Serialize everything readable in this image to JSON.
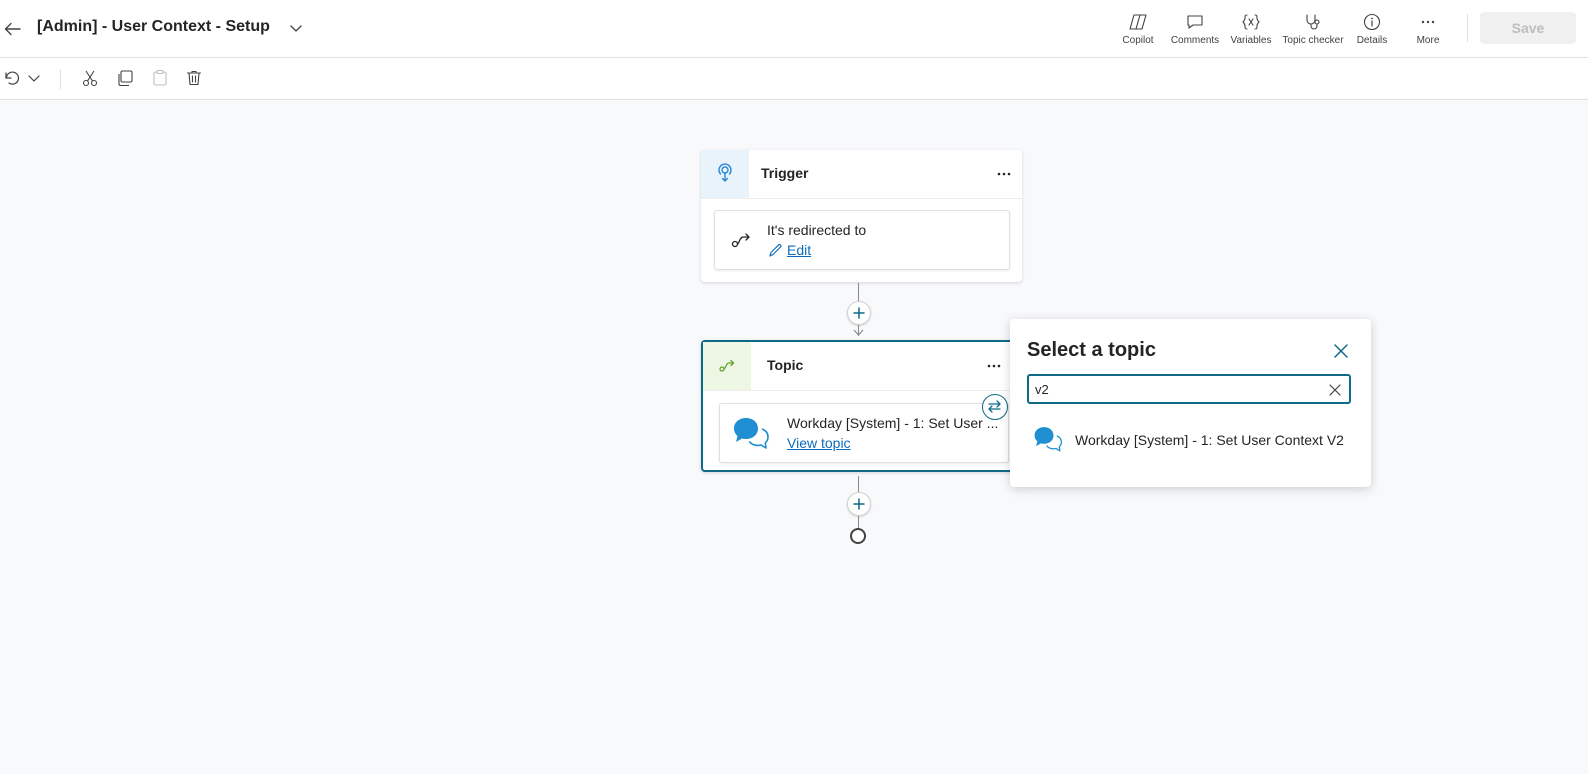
{
  "header": {
    "title": "[Admin] - User Context - Setup",
    "commands": [
      {
        "label": "Copilot",
        "icon": "copilot-icon"
      },
      {
        "label": "Comments",
        "icon": "comment-icon"
      },
      {
        "label": "Variables",
        "icon": "variables-icon"
      },
      {
        "label": "Topic checker",
        "icon": "stethoscope-icon"
      },
      {
        "label": "Details",
        "icon": "info-icon"
      },
      {
        "label": "More",
        "icon": "more-icon"
      }
    ],
    "save_label": "Save"
  },
  "toolbar": {
    "buttons": [
      "undo-icon",
      "chevron-down-icon",
      "cut-icon",
      "copy-icon",
      "paste-icon",
      "delete-icon"
    ]
  },
  "canvas": {
    "trigger_node": {
      "title": "Trigger",
      "condition": "It's redirected to",
      "edit_label": "Edit"
    },
    "topic_node": {
      "title": "Topic",
      "topic_name": "Workday [System] - 1: Set User ...",
      "view_label": "View topic"
    }
  },
  "popup": {
    "title": "Select a topic",
    "search_value": "v2",
    "results": [
      {
        "label": "Workday [System] - 1: Set User Context V2"
      }
    ]
  },
  "colors": {
    "accent": "#0f6a88",
    "link": "#0f6cbd",
    "trigger_icon_bg": "#e8f3fc",
    "topic_icon_bg": "#eef7e4"
  }
}
